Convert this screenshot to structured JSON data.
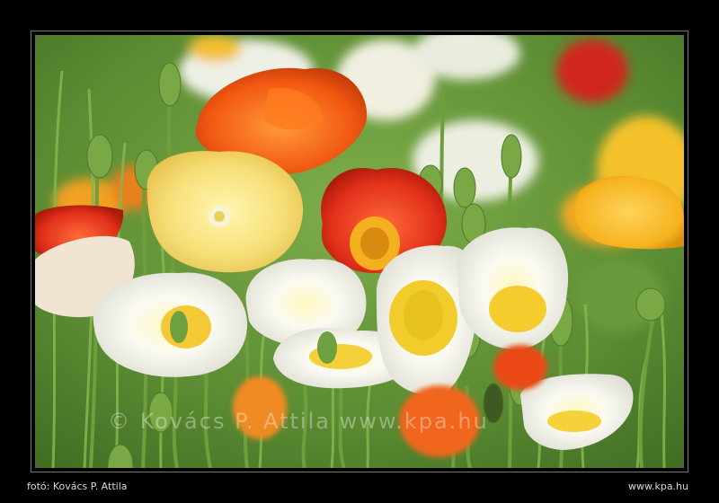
{
  "caption": {
    "photographer": "fotó: Kovács P. Attila",
    "site": "www.kpa.hu"
  },
  "watermark": "© Kovács P. Attila  www.kpa.hu",
  "colors": {
    "background": "#000000",
    "foliage": "#5f8f3a",
    "poppy_red": "#e8421a",
    "poppy_orange": "#f26a12",
    "poppy_yellow": "#f7c531",
    "poppy_white": "#f7f5ee"
  }
}
